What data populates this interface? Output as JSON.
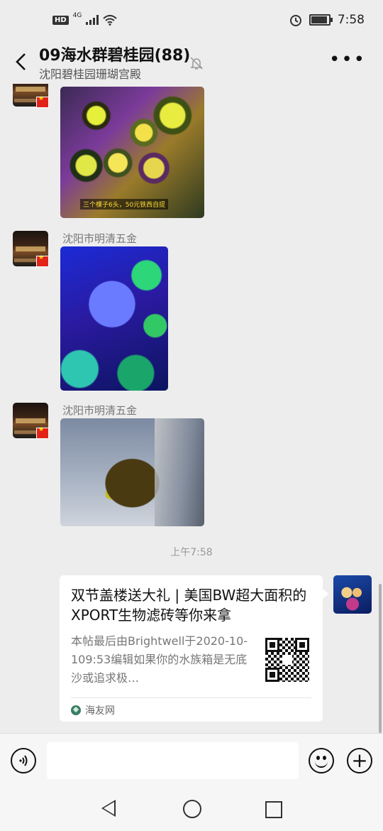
{
  "status_bar": {
    "hd": "HD",
    "network": "4G",
    "time": "7:58",
    "icons": [
      "signal-icon",
      "wifi-icon",
      "alarm-icon",
      "battery-icon"
    ],
    "battery_level": 0.85
  },
  "header": {
    "title": "09海水群碧桂园(88)",
    "subtitle": "沈阳碧桂园珊瑚宫殿",
    "icons": [
      "back-icon",
      "mute-bell-icon",
      "more-icon"
    ]
  },
  "messages": [
    {
      "sender": "",
      "type": "image",
      "image_caption": "三个棵子6头，50元铁西自提"
    },
    {
      "sender": "沈阳市明清五金",
      "type": "image"
    },
    {
      "sender": "沈阳市明清五金",
      "type": "image"
    }
  ],
  "timestamp": "上午7:58",
  "link_card": {
    "title": "双节盖楼送大礼 | 美国BW超大面积的XPORT生物滤砖等你来拿",
    "description": "本帖最后由Brightwell于2020-10-109:53编辑如果你的水族箱是无底沙或追求极…",
    "source": "海友网"
  },
  "input_bar": {
    "icons": [
      "voice-icon",
      "emoji-icon",
      "plus-icon"
    ]
  },
  "nav_bar": {
    "icons": [
      "nav-back-icon",
      "nav-home-icon",
      "nav-recent-icon"
    ]
  }
}
